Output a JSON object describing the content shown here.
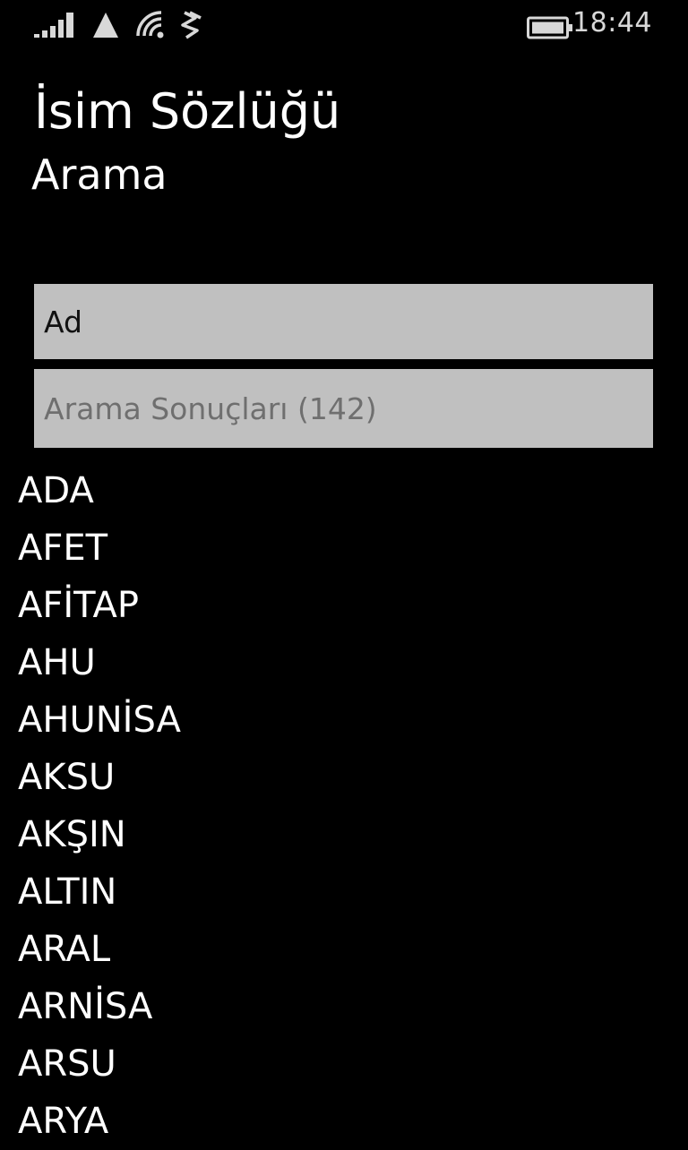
{
  "status_bar": {
    "time": "18:44",
    "icons": [
      "signal-bars-icon",
      "network-triangle-icon",
      "wifi-icon",
      "data-sense-icon",
      "battery-icon"
    ]
  },
  "header": {
    "app_title": "İsim Sözlüğü",
    "page_subtitle": "Arama"
  },
  "search": {
    "value": "Ad",
    "results_label": "Arama Sonuçları (142)"
  },
  "names": [
    "ADA",
    "AFET",
    "AFİTAP",
    "AHU",
    "AHUNİSA",
    "AKSU",
    "AKŞIN",
    "ALTIN",
    "ARAL",
    "ARNİSA",
    "ARSU",
    "ARYA"
  ],
  "colors": {
    "background": "#000000",
    "text": "#ffffff",
    "field_background": "#c0c0c0",
    "placeholder_text": "#6f6f6f"
  }
}
